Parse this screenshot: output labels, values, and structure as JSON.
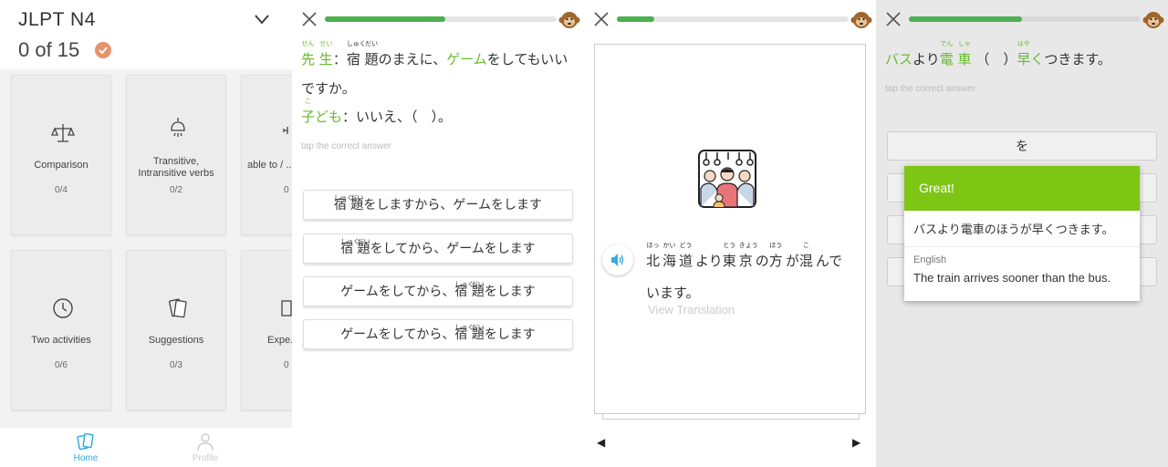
{
  "home": {
    "title": "JLPT N4",
    "progress": "0 of 15",
    "cards": [
      {
        "name": "Comparison",
        "count": "0/4",
        "icon": "scales-icon"
      },
      {
        "name": "Transitive,\nIntransitive verbs",
        "count": "0/2",
        "icon": "lamp-icon"
      },
      {
        "name": "able to / ...",
        "count": "0",
        "icon": "lock-icon"
      },
      {
        "name": "Two activities",
        "count": "0/6",
        "icon": "clock-icon"
      },
      {
        "name": "Suggestions",
        "count": "0/3",
        "icon": "cards-icon"
      },
      {
        "name": "Expe...",
        "count": "0",
        "icon": "calendar-icon"
      }
    ],
    "nav": {
      "home": "Home",
      "profile": "Profile"
    },
    "accent": "#29a9e1",
    "check_color": "#e8926a"
  },
  "lesson1": {
    "progress": 0.52,
    "line1": {
      "kanji1": "先",
      "furi1": "せん",
      "kanji2": "生",
      "furi2": "せい",
      "colon": "：",
      "kanji3": "宿",
      "furi3": "しゅく",
      "kanji4": "題",
      "furi4": "だい",
      "mid": "のまえに、",
      "game": "ゲーム",
      "end": "をしてもいい"
    },
    "line2": "ですか。",
    "line3": {
      "kanji": "子",
      "furi": "こ",
      "rest_green": "ども",
      "rest": "：いいえ、（　）。"
    },
    "hint": "tap the correct answer",
    "answers": [
      {
        "k1": "宿",
        "f1": "しゅく",
        "k2": "題",
        "f2": "だい",
        "text": "をしますから、ゲームをします"
      },
      {
        "k1": "宿",
        "f1": "しゅく",
        "k2": "題",
        "f2": "だい",
        "text": "をしてから、ゲームをします"
      },
      {
        "pre": "ゲームをしてから、",
        "k1": "宿",
        "f1": "しゅく",
        "k2": "題",
        "f2": "だい",
        "text": "をします"
      },
      {
        "pre": "ゲームをしてから、",
        "k1": "宿",
        "f1": "しゅく",
        "k2": "題",
        "f2": "だい",
        "text": "をします"
      }
    ]
  },
  "lesson2": {
    "progress": 0.16,
    "sentence": [
      {
        "k": "北",
        "f": "ほっ"
      },
      {
        "k": "海",
        "f": "かい"
      },
      {
        "k": "道",
        "f": "どう"
      },
      {
        "t": "より"
      },
      {
        "k": "東",
        "f": "とう"
      },
      {
        "k": "京",
        "f": "きょう"
      },
      {
        "t": "の"
      },
      {
        "k": "方",
        "f": "ほう"
      },
      {
        "t": "が"
      },
      {
        "k": "混",
        "f": "こ"
      },
      {
        "t": "んで"
      }
    ],
    "sentence_line2": "います。",
    "view_translation": "View Translation",
    "prev_arrow": "◀",
    "next_arrow": "▶"
  },
  "lesson3": {
    "progress": 0.49,
    "sentence": {
      "a": "バス",
      "b": "より",
      "k1": "電",
      "f1": "でん",
      "k2": "車",
      "f2": "しゃ",
      "paren": "（　）",
      "k3": "早",
      "f3": "はや",
      "g": "く",
      "end": "つきます。"
    },
    "hint": "tap the correct answer",
    "answers": [
      "を",
      "",
      "",
      ""
    ],
    "popup": {
      "header": "Great!",
      "sentence": "バスより電車のほうが早くつきます。",
      "lang": "English",
      "translation": "The train arrives sooner than the bus."
    }
  }
}
